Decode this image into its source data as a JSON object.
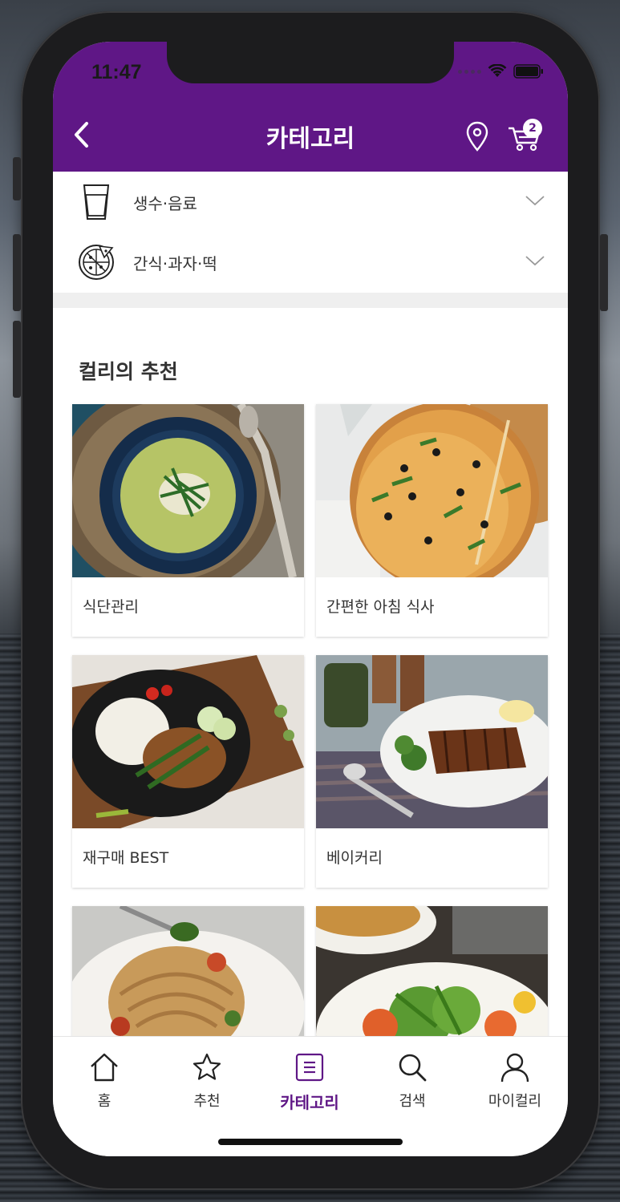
{
  "status_bar": {
    "time": "11:47"
  },
  "header": {
    "title": "카테고리",
    "cart_count": "2"
  },
  "categories": [
    {
      "label": "생수·음료",
      "icon": "glass-icon"
    },
    {
      "label": "간식·과자·떡",
      "icon": "pizza-icon"
    }
  ],
  "recommend": {
    "title": "컬리의 추천",
    "cards": [
      {
        "label": "식단관리",
        "image": "green-soup-bowl"
      },
      {
        "label": "간편한 아침 식사",
        "image": "pizza"
      },
      {
        "label": "재구매 BEST",
        "image": "rice-plate"
      },
      {
        "label": "베이커리",
        "image": "steak-plate"
      },
      {
        "label": "",
        "image": "pasta"
      },
      {
        "label": "",
        "image": "salad"
      }
    ]
  },
  "tabbar": {
    "tabs": [
      {
        "label": "홈",
        "icon": "home-icon"
      },
      {
        "label": "추천",
        "icon": "star-icon"
      },
      {
        "label": "카테고리",
        "icon": "list-icon",
        "active": true
      },
      {
        "label": "검색",
        "icon": "search-icon"
      },
      {
        "label": "마이컬리",
        "icon": "person-icon"
      }
    ]
  },
  "colors": {
    "brand": "#5f1786",
    "text": "#333333",
    "divider": "#efefef"
  }
}
